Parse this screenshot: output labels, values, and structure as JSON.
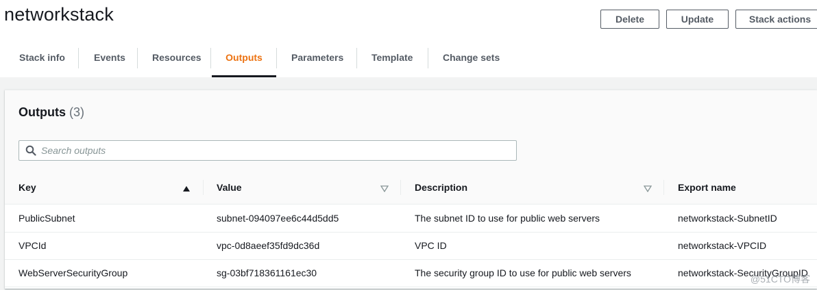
{
  "header": {
    "title": "networkstack",
    "buttons": {
      "delete": "Delete",
      "update": "Update",
      "stack_actions": "Stack actions"
    }
  },
  "tabs": [
    "Stack info",
    "Events",
    "Resources",
    "Outputs",
    "Parameters",
    "Template",
    "Change sets"
  ],
  "active_tab": "Outputs",
  "outputs": {
    "title": "Outputs",
    "count": "(3)",
    "search_placeholder": "Search outputs",
    "columns": [
      "Key",
      "Value",
      "Description",
      "Export name"
    ],
    "rows": [
      [
        "PublicSubnet",
        "subnet-094097ee6c44d5dd5",
        "The subnet ID to use for public web servers",
        "networkstack-SubnetID"
      ],
      [
        "VPCId",
        "vpc-0d8aeef35fd9dc36d",
        "VPC ID",
        "networkstack-VPCID"
      ],
      [
        "WebServerSecurityGroup",
        "sg-03bf718361161ec30",
        "The security group ID to use for public web servers",
        "networkstack-SecurityGroupID"
      ]
    ]
  },
  "watermark": "@51CTO博客",
  "colors": {
    "active_tab": "#ec7211",
    "text": "#16191f",
    "muted": "#545b64"
  }
}
